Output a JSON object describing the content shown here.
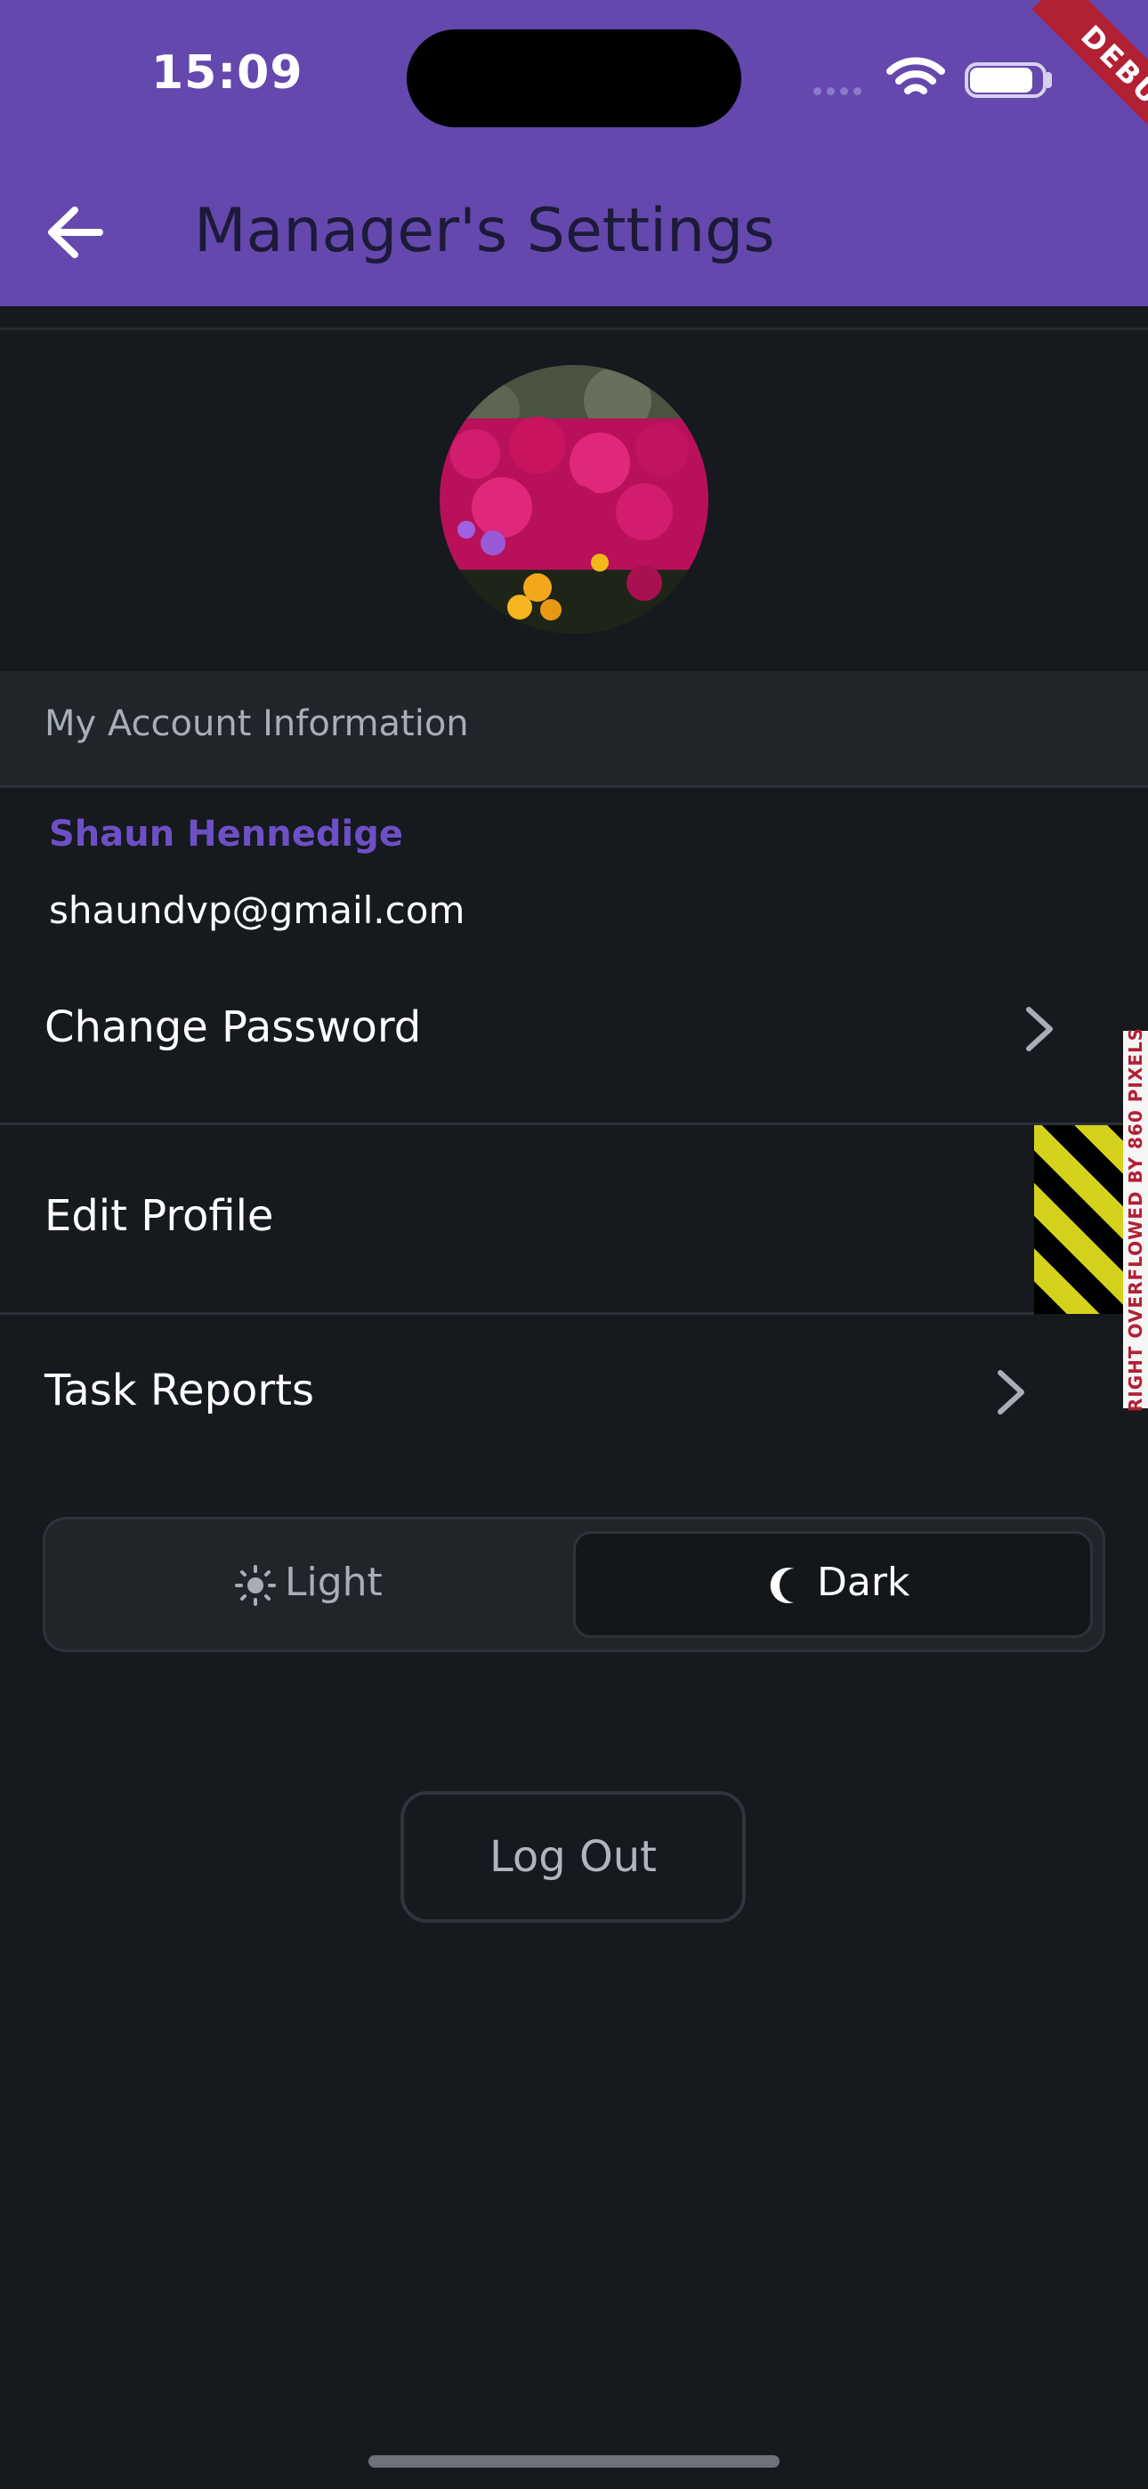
{
  "status_bar": {
    "time": "15:09",
    "debug_banner": "DEBUG"
  },
  "header": {
    "title": "Manager's Settings"
  },
  "section": {
    "label": "My Account Information"
  },
  "user": {
    "name": "Shaun Hennedige",
    "email": "shaundvp@gmail.com"
  },
  "menu": {
    "items": [
      {
        "label": "Change Password"
      },
      {
        "label": "Edit Profile"
      },
      {
        "label": "Task Reports"
      }
    ],
    "overflow_warning": "RIGHT OVERFLOWED BY 860 PIXELS"
  },
  "theme_toggle": {
    "light_label": "Light",
    "dark_label": "Dark",
    "selected": "Dark"
  },
  "logout_label": "Log Out",
  "colors": {
    "header_bg": "#6448ad",
    "background": "#16191d",
    "name_accent": "#6d4fc6",
    "debug_red": "#b22034"
  },
  "icons": [
    "back-arrow-icon",
    "wifi-icon",
    "battery-icon",
    "chevron-right-icon",
    "sun-icon",
    "moon-icon"
  ]
}
